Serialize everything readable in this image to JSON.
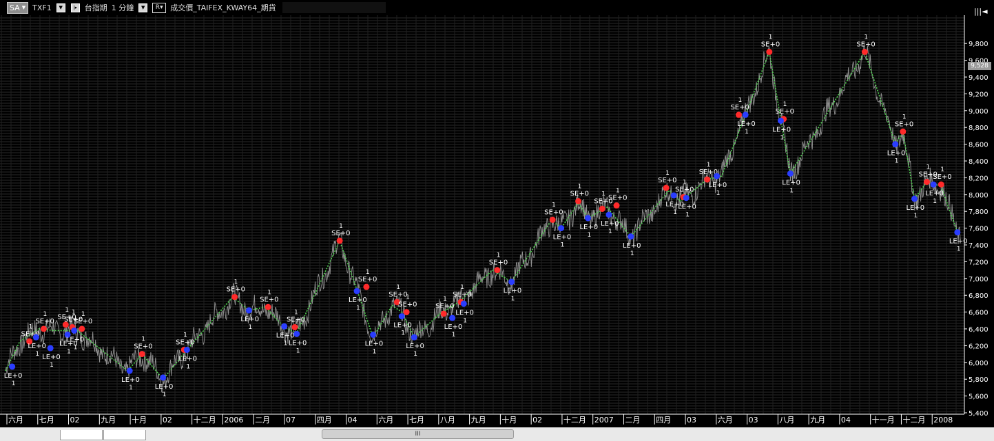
{
  "toolbar": {
    "sa_label": "SA",
    "symbol": "TXF1",
    "name": "台指期",
    "interval": "1 分鐘",
    "r_label": "R",
    "source": "成交價_TAIFEX_KWAY64_期貨"
  },
  "corner_button": "|||◄",
  "price_tag": "9,528",
  "scroll_thumb_label": "III",
  "colors": {
    "background": "#000000",
    "price_series": "#aaaaaa",
    "signal_line": "#4fd34f",
    "short_marker": "#ff2a2a",
    "long_marker": "#2a3dff",
    "axis": "#ffffff"
  },
  "chart_data": {
    "type": "line",
    "y_axis_ticks": [
      "5,400",
      "5,600",
      "5,800",
      "6,000",
      "6,200",
      "6,400",
      "6,600",
      "6,800",
      "7,000",
      "7,200",
      "7,400",
      "7,600",
      "7,800",
      "8,000",
      "8,200",
      "8,400",
      "8,600",
      "8,800",
      "9,000",
      "9,200",
      "9,400",
      "9,600",
      "9,800"
    ],
    "ylim": [
      5400,
      9900
    ],
    "x_axis_labels": [
      "六月",
      "七月",
      "02",
      "九月",
      "十月",
      "02",
      "十二月",
      "2006",
      "二月",
      "07",
      "四月",
      "04",
      "六月",
      "七月",
      "八月",
      "九月",
      "十月",
      "02",
      "十二月",
      "2007",
      "二月",
      "四月",
      "03",
      "六月",
      "03",
      "八月",
      "九月",
      "04",
      "十一月",
      "十二月",
      "2008"
    ],
    "signal_path": [
      {
        "x": 0.0,
        "y": 5900
      },
      {
        "x": 0.015,
        "y": 6250
      },
      {
        "x": 0.035,
        "y": 6400
      },
      {
        "x": 0.05,
        "y": 6380
      },
      {
        "x": 0.075,
        "y": 6380
      },
      {
        "x": 0.095,
        "y": 6200
      },
      {
        "x": 0.128,
        "y": 5900
      },
      {
        "x": 0.143,
        "y": 6100
      },
      {
        "x": 0.165,
        "y": 5800
      },
      {
        "x": 0.19,
        "y": 6150
      },
      {
        "x": 0.238,
        "y": 6780
      },
      {
        "x": 0.255,
        "y": 6620
      },
      {
        "x": 0.272,
        "y": 6660
      },
      {
        "x": 0.292,
        "y": 6420
      },
      {
        "x": 0.305,
        "y": 6350
      },
      {
        "x": 0.35,
        "y": 7450
      },
      {
        "x": 0.368,
        "y": 6870
      },
      {
        "x": 0.385,
        "y": 6300
      },
      {
        "x": 0.405,
        "y": 6680
      },
      {
        "x": 0.415,
        "y": 6600
      },
      {
        "x": 0.428,
        "y": 6300
      },
      {
        "x": 0.455,
        "y": 6580
      },
      {
        "x": 0.475,
        "y": 6720
      },
      {
        "x": 0.51,
        "y": 7100
      },
      {
        "x": 0.53,
        "y": 6960
      },
      {
        "x": 0.572,
        "y": 7700
      },
      {
        "x": 0.582,
        "y": 7600
      },
      {
        "x": 0.6,
        "y": 7900
      },
      {
        "x": 0.61,
        "y": 7720
      },
      {
        "x": 0.63,
        "y": 7850
      },
      {
        "x": 0.655,
        "y": 7500
      },
      {
        "x": 0.695,
        "y": 8050
      },
      {
        "x": 0.707,
        "y": 7920
      },
      {
        "x": 0.735,
        "y": 8180
      },
      {
        "x": 0.75,
        "y": 8220
      },
      {
        "x": 0.775,
        "y": 8950
      },
      {
        "x": 0.8,
        "y": 9700
      },
      {
        "x": 0.812,
        "y": 8900
      },
      {
        "x": 0.822,
        "y": 8250
      },
      {
        "x": 0.9,
        "y": 9700
      },
      {
        "x": 0.932,
        "y": 8600
      },
      {
        "x": 0.94,
        "y": 8750
      },
      {
        "x": 0.952,
        "y": 7950
      },
      {
        "x": 0.965,
        "y": 8150
      },
      {
        "x": 0.98,
        "y": 8100
      },
      {
        "x": 0.997,
        "y": 7550
      }
    ],
    "short_entries": [
      {
        "x": 0.025,
        "y": 6250,
        "label": "SE+0"
      },
      {
        "x": 0.04,
        "y": 6400,
        "label": "SE+0"
      },
      {
        "x": 0.063,
        "y": 6450,
        "label": "SE+0"
      },
      {
        "x": 0.07,
        "y": 6420,
        "label": "SE+0"
      },
      {
        "x": 0.08,
        "y": 6400,
        "label": "SE+0"
      },
      {
        "x": 0.143,
        "y": 6100,
        "label": "SE+0"
      },
      {
        "x": 0.187,
        "y": 6150,
        "label": "SE+0"
      },
      {
        "x": 0.24,
        "y": 6780,
        "label": "SE+0"
      },
      {
        "x": 0.275,
        "y": 6660,
        "label": "SE+0"
      },
      {
        "x": 0.303,
        "y": 6420,
        "label": "SE+0"
      },
      {
        "x": 0.35,
        "y": 7450,
        "label": "SE+0"
      },
      {
        "x": 0.378,
        "y": 6900,
        "label": "SE+0"
      },
      {
        "x": 0.41,
        "y": 6720,
        "label": "SE+0"
      },
      {
        "x": 0.42,
        "y": 6600,
        "label": "SE+0"
      },
      {
        "x": 0.459,
        "y": 6580,
        "label": "SE+0"
      },
      {
        "x": 0.477,
        "y": 6720,
        "label": "SE+0"
      },
      {
        "x": 0.515,
        "y": 7100,
        "label": "SE+0"
      },
      {
        "x": 0.573,
        "y": 7700,
        "label": "SE+0"
      },
      {
        "x": 0.6,
        "y": 7920,
        "label": "SE+0"
      },
      {
        "x": 0.625,
        "y": 7830,
        "label": "SE+0"
      },
      {
        "x": 0.64,
        "y": 7870,
        "label": "SE+0"
      },
      {
        "x": 0.692,
        "y": 8080,
        "label": "SE+0"
      },
      {
        "x": 0.71,
        "y": 7970,
        "label": "SE+0"
      },
      {
        "x": 0.735,
        "y": 8180,
        "label": "SE+0"
      },
      {
        "x": 0.768,
        "y": 8950,
        "label": "SE+0"
      },
      {
        "x": 0.8,
        "y": 9700,
        "label": "SE+0"
      },
      {
        "x": 0.815,
        "y": 8900,
        "label": "SE+0"
      },
      {
        "x": 0.9,
        "y": 9700,
        "label": "SE+0"
      },
      {
        "x": 0.94,
        "y": 8750,
        "label": "SE+0"
      },
      {
        "x": 0.965,
        "y": 8150,
        "label": "SE+0"
      },
      {
        "x": 0.98,
        "y": 8120,
        "label": "SE+0"
      }
    ],
    "long_entries": [
      {
        "x": 0.007,
        "y": 5950,
        "label": "LE+0"
      },
      {
        "x": 0.032,
        "y": 6300,
        "label": "LE+0"
      },
      {
        "x": 0.047,
        "y": 6170,
        "label": "LE+0"
      },
      {
        "x": 0.065,
        "y": 6330,
        "label": "LE+0"
      },
      {
        "x": 0.072,
        "y": 6380,
        "label": "LE+0"
      },
      {
        "x": 0.13,
        "y": 5900,
        "label": "LE+0"
      },
      {
        "x": 0.165,
        "y": 5820,
        "label": "LE+0"
      },
      {
        "x": 0.19,
        "y": 6150,
        "label": "LE+0"
      },
      {
        "x": 0.255,
        "y": 6620,
        "label": "LE+0"
      },
      {
        "x": 0.292,
        "y": 6430,
        "label": "LE+0"
      },
      {
        "x": 0.305,
        "y": 6340,
        "label": "LE+0"
      },
      {
        "x": 0.368,
        "y": 6850,
        "label": "LE+0"
      },
      {
        "x": 0.385,
        "y": 6330,
        "label": "LE+0"
      },
      {
        "x": 0.415,
        "y": 6550,
        "label": "LE+0"
      },
      {
        "x": 0.428,
        "y": 6300,
        "label": "LE+0"
      },
      {
        "x": 0.468,
        "y": 6530,
        "label": "LE+0"
      },
      {
        "x": 0.48,
        "y": 6700,
        "label": "LE+0"
      },
      {
        "x": 0.53,
        "y": 6960,
        "label": "LE+0"
      },
      {
        "x": 0.582,
        "y": 7600,
        "label": "LE+0"
      },
      {
        "x": 0.61,
        "y": 7720,
        "label": "LE+0"
      },
      {
        "x": 0.632,
        "y": 7760,
        "label": "LE+0"
      },
      {
        "x": 0.655,
        "y": 7500,
        "label": "LE+0"
      },
      {
        "x": 0.7,
        "y": 7990,
        "label": "LE+0"
      },
      {
        "x": 0.713,
        "y": 7960,
        "label": "LE+0"
      },
      {
        "x": 0.745,
        "y": 8220,
        "label": "LE+0"
      },
      {
        "x": 0.775,
        "y": 8950,
        "label": "LE+0"
      },
      {
        "x": 0.812,
        "y": 8880,
        "label": "LE+0"
      },
      {
        "x": 0.822,
        "y": 8250,
        "label": "LE+0"
      },
      {
        "x": 0.932,
        "y": 8600,
        "label": "LE+0"
      },
      {
        "x": 0.952,
        "y": 7950,
        "label": "LE+0"
      },
      {
        "x": 0.972,
        "y": 8120,
        "label": "LE+0"
      },
      {
        "x": 0.997,
        "y": 7550,
        "label": "LE+0"
      }
    ],
    "quantity_label": "1"
  }
}
